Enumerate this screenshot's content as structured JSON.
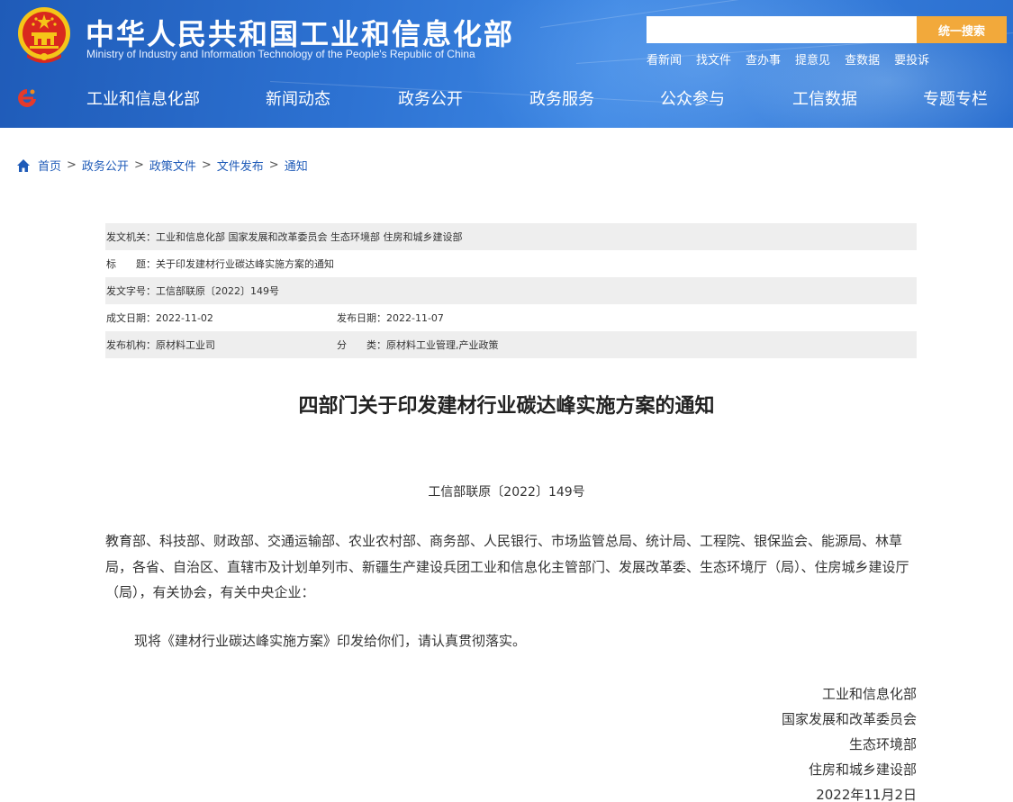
{
  "header": {
    "site_title": "中华人民共和国工业和信息化部",
    "site_subtitle": "Ministry of Industry and Information Technology of the People's Republic of China",
    "search": {
      "placeholder": "",
      "button_label": "统一搜索"
    },
    "quick_links": [
      "看新闻",
      "找文件",
      "查办事",
      "提意见",
      "查数据",
      "要投诉"
    ],
    "nav": [
      "工业和信息化部",
      "新闻动态",
      "政务公开",
      "政务服务",
      "公众参与",
      "工信数据",
      "专题专栏"
    ],
    "colors": {
      "header_blue": "#2d72d2",
      "search_button": "#f2a93b",
      "emblem_red": "#d9281e",
      "emblem_gold": "#f5c518"
    }
  },
  "breadcrumb": {
    "items": [
      "首页",
      "政务公开",
      "政策文件",
      "文件发布",
      "通知"
    ],
    "separator": ">",
    "icon": "home-icon"
  },
  "info": {
    "issuer_label": "发文机关：",
    "issuer_value": "工业和信息化部 国家发展和改革委员会 生态环境部 住房和城乡建设部",
    "title_label": "标　　题：",
    "title_value": "关于印发建材行业碳达峰实施方案的通知",
    "docno_label": "发文字号：",
    "docno_value": "工信部联原〔2022〕149号",
    "created_label": "成文日期：",
    "created_value": "2022-11-02",
    "published_label": "发布日期：",
    "published_value": "2022-11-07",
    "agency_label": "发布机构：",
    "agency_value": "原材料工业司",
    "category_label": "分　　类：",
    "category_value": "原材料工业管理,产业政策"
  },
  "article": {
    "title": "四部门关于印发建材行业碳达峰实施方案的通知",
    "doc_number": "工信部联原〔2022〕149号",
    "recipients": "教育部、科技部、财政部、交通运输部、农业农村部、商务部、人民银行、市场监管总局、统计局、工程院、银保监会、能源局、林草局，各省、自治区、直辖市及计划单列市、新疆生产建设兵团工业和信息化主管部门、发展改革委、生态环境厅（局）、住房城乡建设厅（局），有关协会，有关中央企业：",
    "paragraph": "现将《建材行业碳达峰实施方案》印发给你们，请认真贯彻落实。",
    "signatures": [
      "工业和信息化部",
      "国家发展和改革委员会",
      "生态环境部",
      "住房和城乡建设部",
      "2022年11月2日"
    ]
  }
}
